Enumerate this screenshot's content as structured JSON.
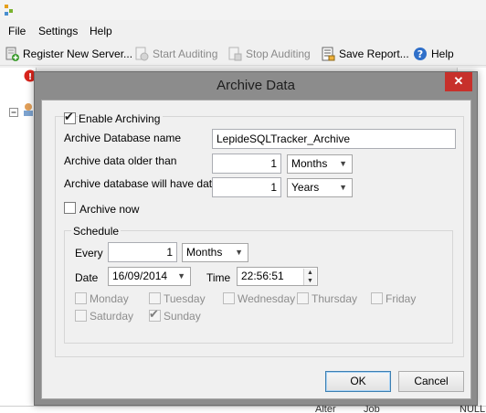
{
  "menu": {
    "file": "File",
    "settings": "Settings",
    "help": "Help"
  },
  "toolbar": {
    "register": "Register New Server...",
    "start": "Start Auditing",
    "stop": "Stop Auditing",
    "save": "Save Report...",
    "help": "Help"
  },
  "background": {
    "alter": "Alter",
    "job": "Job",
    "null": "NULL"
  },
  "dialog": {
    "title": "Archive Data",
    "close": "✕",
    "enable_archiving": "Enable Archiving",
    "db_name_label": "Archive Database name",
    "db_name_value": "LepideSQLTracker_Archive",
    "older_than_label": "Archive data older than",
    "older_than_value": "1",
    "older_than_unit": "Months",
    "will_have_label": "Archive database will have data",
    "will_have_value": "1",
    "will_have_unit": "Years",
    "archive_now": "Archive now",
    "schedule": {
      "title": "Schedule",
      "every_label": "Every",
      "every_value": "1",
      "every_unit": "Months",
      "date_label": "Date",
      "date_value": "16/09/2014",
      "time_label": "Time",
      "time_value": "22:56:51",
      "days": [
        "Monday",
        "Tuesday",
        "Wednesday",
        "Thursday",
        "Friday",
        "Saturday",
        "Sunday"
      ]
    },
    "ok": "OK",
    "cancel": "Cancel"
  }
}
